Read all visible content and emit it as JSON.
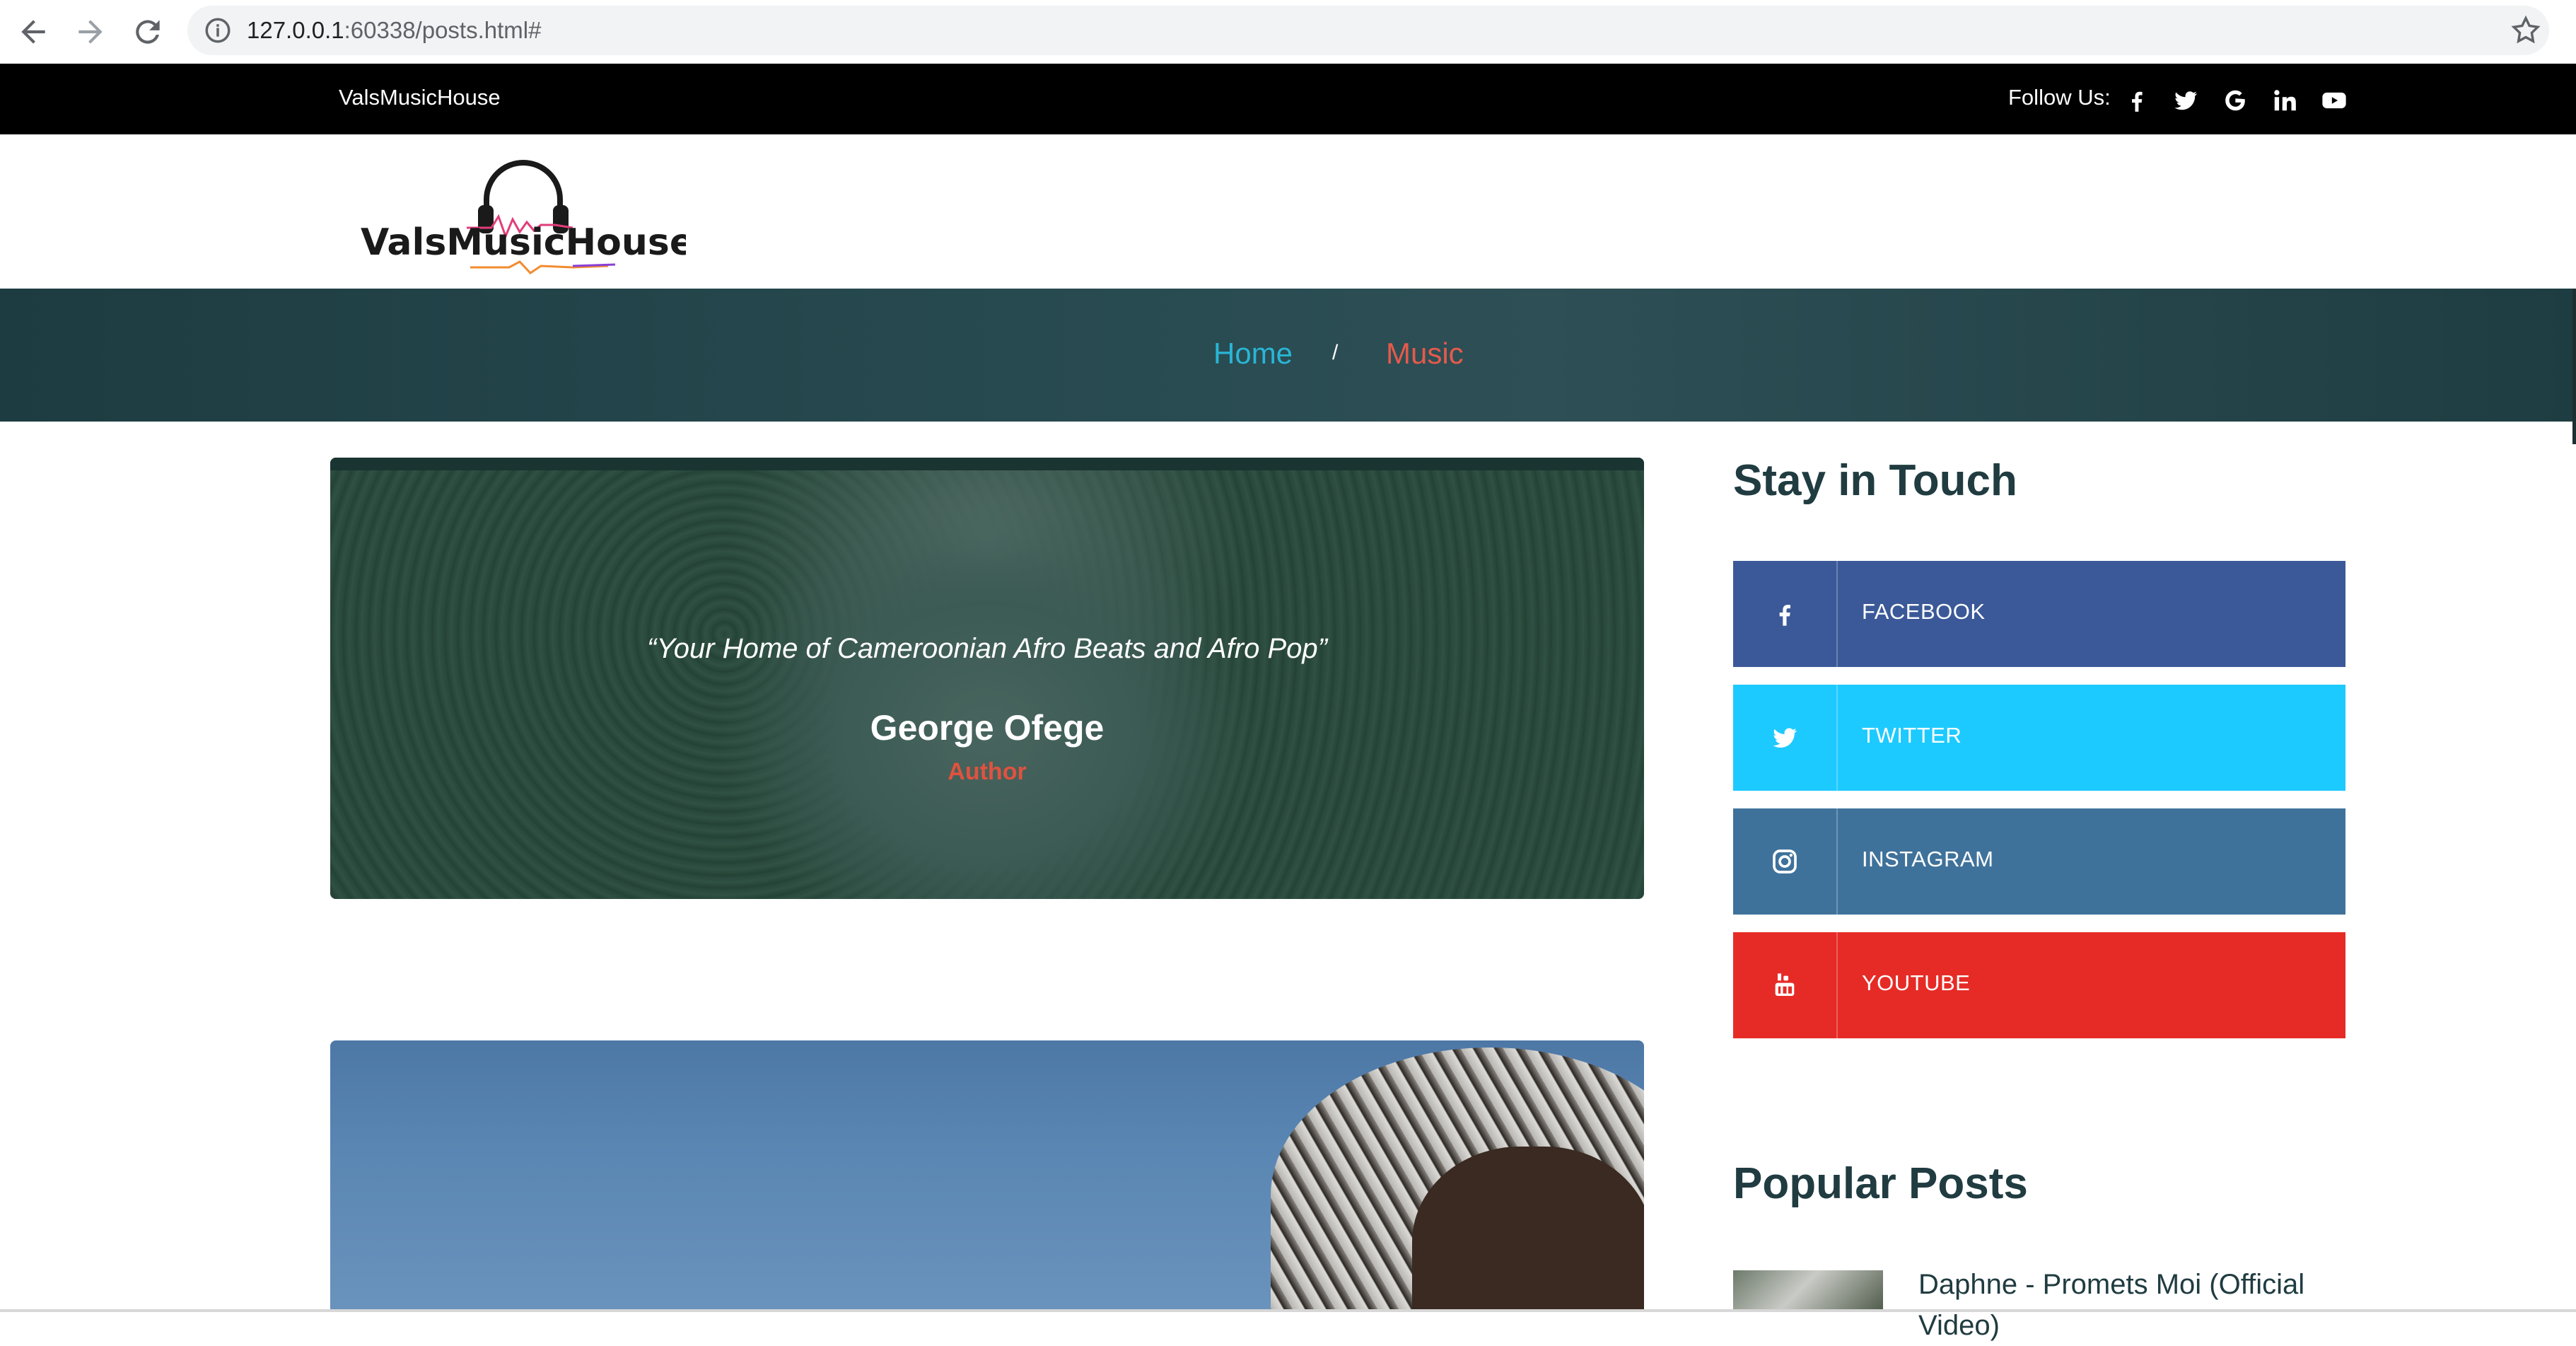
{
  "browser": {
    "url_host": "127.0.0.1",
    "url_rest": ":60338/posts.html#"
  },
  "topbar": {
    "brand": "ValsMusicHouse",
    "follow_label": "Follow Us:",
    "social_icons": [
      "facebook-icon",
      "twitter-icon",
      "google-icon",
      "linkedin-icon",
      "youtube-icon"
    ]
  },
  "logo": {
    "text": "ValsMusicHouse"
  },
  "breadcrumb": {
    "home": "Home",
    "separator": "/",
    "current": "Music"
  },
  "post1": {
    "quote": "“Your Home of Cameroonian Afro Beats and Afro Pop”",
    "author": "George Ofege",
    "role": "Author"
  },
  "sidebar": {
    "stay_title": "Stay in Touch",
    "buttons": [
      {
        "label": "FACEBOOK",
        "icon": "facebook-icon",
        "color": "#3b5998"
      },
      {
        "label": "TWITTER",
        "icon": "twitter-icon",
        "color": "#1dcaff"
      },
      {
        "label": "INSTAGRAM",
        "icon": "instagram-icon",
        "color": "#3f729b"
      },
      {
        "label": "YOUTUBE",
        "icon": "youtube-icon",
        "color": "#e62b26"
      }
    ],
    "popular_title": "Popular Posts",
    "popular_posts": [
      {
        "title": "Daphne - Promets Moi (Official Video)"
      }
    ]
  },
  "colors": {
    "topbar_bg": "#000000",
    "breadcrumb_bg": "#274a50",
    "home_link": "#29b5d6",
    "current_crumb": "#e55a4c",
    "heading": "#203c41"
  }
}
